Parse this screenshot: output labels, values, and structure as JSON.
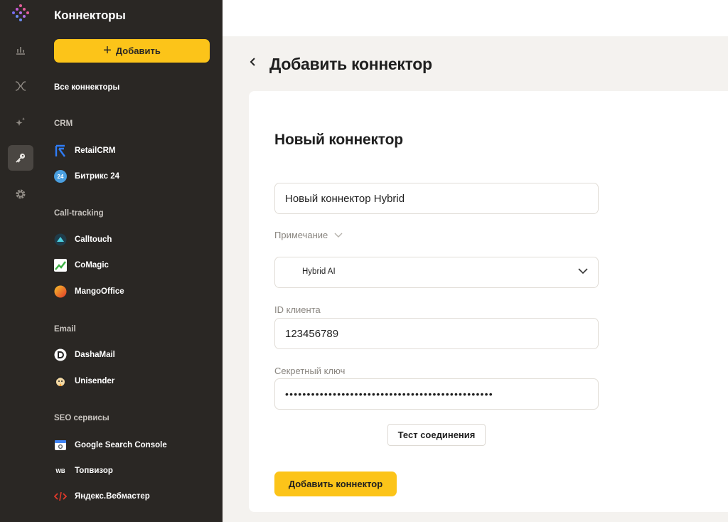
{
  "sidebar": {
    "title": "Коннекторы",
    "add_label": "Добавить",
    "all_label": "Все коннекторы",
    "categories": {
      "crm": "CRM",
      "calltracking": "Call-tracking",
      "email": "Email",
      "seo": "SEO сервисы"
    },
    "items": {
      "retailcrm": "RetailCRM",
      "bitrix": "Битрикс 24",
      "bitrix_badge": "24",
      "calltouch": "Calltouch",
      "comagic": "CoMagic",
      "mangooffice": "MangoOffice",
      "dashamail": "DashaMail",
      "unisender": "Unisender",
      "gsc": "Google Search Console",
      "topvisor": "Топвизор",
      "topvisor_badge": "WB",
      "yandex": "Яндекс.Вебмастер"
    }
  },
  "main": {
    "page_title": "Добавить коннектор",
    "card_title": "Новый коннектор",
    "name_value": "Новый коннектор Hybrid",
    "note_label": "Примечание",
    "select_value": "Hybrid AI",
    "client_id_label": "ID клиента",
    "client_id_value": "123456789",
    "secret_label": "Секретный ключ",
    "secret_value": "••••••••••••••••••••••••••••••••••••••••••••••••",
    "test_button": "Тест соединения",
    "submit_button": "Добавить коннектор"
  },
  "colors": {
    "sidebar_bg": "#2a2724",
    "accent": "#fcc419",
    "page_bg": "#f4f2ef"
  },
  "icons": {
    "rail": [
      "logo-icon",
      "chart-icon",
      "merge-icon",
      "sparkle-icon",
      "key-icon",
      "gear-icon"
    ]
  }
}
